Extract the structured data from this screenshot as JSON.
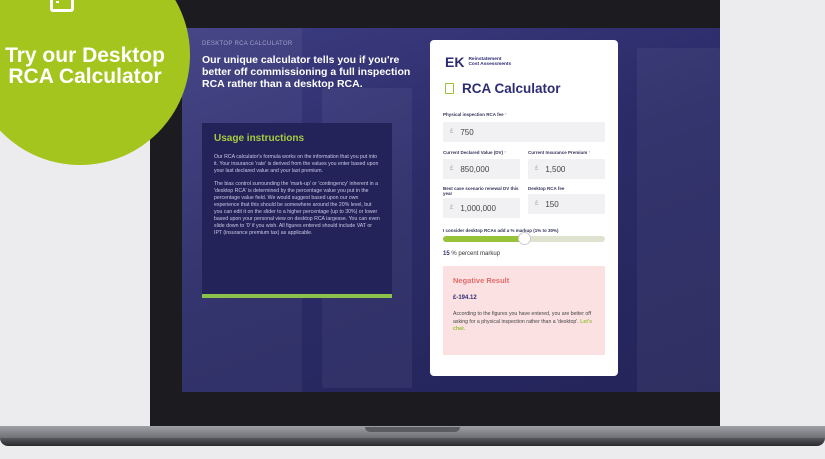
{
  "badge": {
    "icon": "calculator-icon",
    "text": "Try our Desktop RCA Calculator",
    "color": "#a4c41e"
  },
  "screen": {
    "kicker": "DESKTOP RCA CALCULATOR",
    "headline": "Our unique calculator tells you if you're better off commissioning a full inspection RCA rather than a desktop RCA.",
    "card": {
      "title": "Usage instructions",
      "p1": "Our RCA calculator's formula works on the information that you put into it. Your insurance 'rate' is derived from the values you enter based upon your last declared value and your last premium.",
      "p2": "The bias control surrounding the 'mark-up' or 'contingency' inherent in a 'desktop RCA' is determined by the percentage value you put in the percentage value field. We would suggest based upon our own experience that this should be somewhere around the 20% level, but you can edit it on the slider to a higher percentage (up to 30%) or lower based upon your personal view on desktop RCA largesse. You can even slide down to '0' if you wish. All figures entered should include VAT or IPT (insurance premium tax) as applicable."
    }
  },
  "panel": {
    "logo_mark": "EK",
    "logo_line1": "Reinstatement",
    "logo_line2": "Cost Assessments",
    "title": "RCA Calculator",
    "fields": {
      "physical_label": "Physical inspection RCA fee",
      "physical_value": "750",
      "declared_label": "Current Declared Value (DV)",
      "declared_value": "850,000",
      "premium_label": "Current Insurance Premium",
      "premium_value": "1,500",
      "bestcase_label": "Best case scenario renewal DV this year",
      "bestcase_value": "1,000,000",
      "desktop_label": "Desktop RCA fee",
      "desktop_value": "150",
      "currency": "£",
      "required_mark": "*"
    },
    "slider_label": "I consider desktop RCAs add a % markup (1% to 30%)",
    "slider_fraction": 0.5,
    "markup_value": "15",
    "markup_suffix": "% percent markup",
    "result": {
      "title": "Negative Result",
      "amount": "£-194.12",
      "text": "According to the figures you have entered, you are better off asking for a physical inspection rather than a 'desktop'.",
      "link": "Let's chat."
    }
  }
}
